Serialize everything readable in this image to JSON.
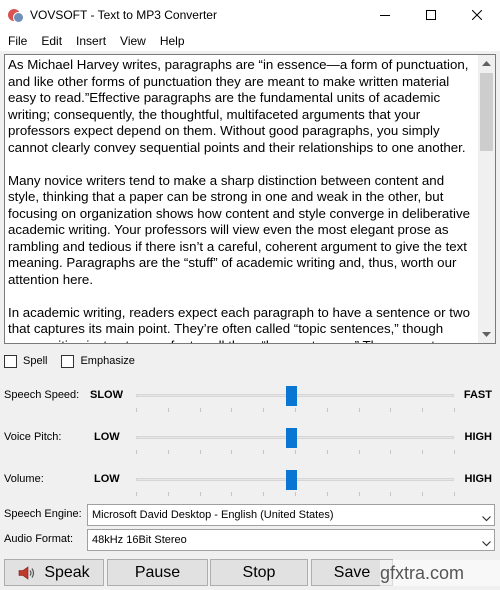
{
  "window": {
    "title": "VOVSOFT - Text to MP3 Converter",
    "controls": [
      {
        "name": "minimize-icon"
      },
      {
        "name": "maximize-icon"
      },
      {
        "name": "close-icon"
      }
    ]
  },
  "menu": [
    "File",
    "Edit",
    "Insert",
    "View",
    "Help"
  ],
  "editor": {
    "paragraphs": [
      "As Michael Harvey writes, paragraphs are “in essence—a form of punctuation, and like other forms of punctuation they are meant to make written material easy to read.”Effective paragraphs are the fundamental units of academic writing; consequently, the thoughtful, multifaceted arguments that your professors expect depend on them. Without good paragraphs, you simply cannot clearly convey sequential points and their relationships to one another.",
      "Many novice writers tend to make a sharp distinction between content and style, thinking that a paper can be strong in one and weak in the other, but focusing on organization shows how content and style converge in deliberative academic writing. Your professors will view even the most elegant prose as rambling and tedious if there isn’t a careful, coherent argument to give the text meaning. Paragraphs are the “stuff” of academic writing and, thus, worth our attention here.",
      "In academic writing, readers expect each paragraph to have a sentence or two that captures its main point. They’re often called “topic sentences,” though many writing instructors  prefer to call them “key sentences.” There are at"
    ]
  },
  "options": {
    "spell_label": "Spell",
    "spell_checked": false,
    "emphasize_label": "Emphasize",
    "emphasize_checked": false
  },
  "sliders": {
    "speed": {
      "label": "Speech Speed:",
      "low": "SLOW",
      "high": "FAST",
      "value": 0.49
    },
    "pitch": {
      "label": "Voice Pitch:",
      "low": "LOW",
      "high": "HIGH",
      "value": 0.49
    },
    "volume": {
      "label": "Volume:",
      "low": "LOW",
      "high": "HIGH",
      "value": 0.49
    }
  },
  "engine": {
    "label": "Speech Engine:",
    "value": "Microsoft David Desktop - English (United States)"
  },
  "format": {
    "label": "Audio Format:",
    "value": "48kHz 16Bit Stereo"
  },
  "buttons": {
    "speak": "Speak",
    "pause": "Pause",
    "stop": "Stop",
    "save": "Save"
  },
  "watermark": {
    "text": "gfxtra.com"
  },
  "colors": {
    "slider_thumb": "#0a76d4",
    "button_face": "#e1e1e1"
  }
}
